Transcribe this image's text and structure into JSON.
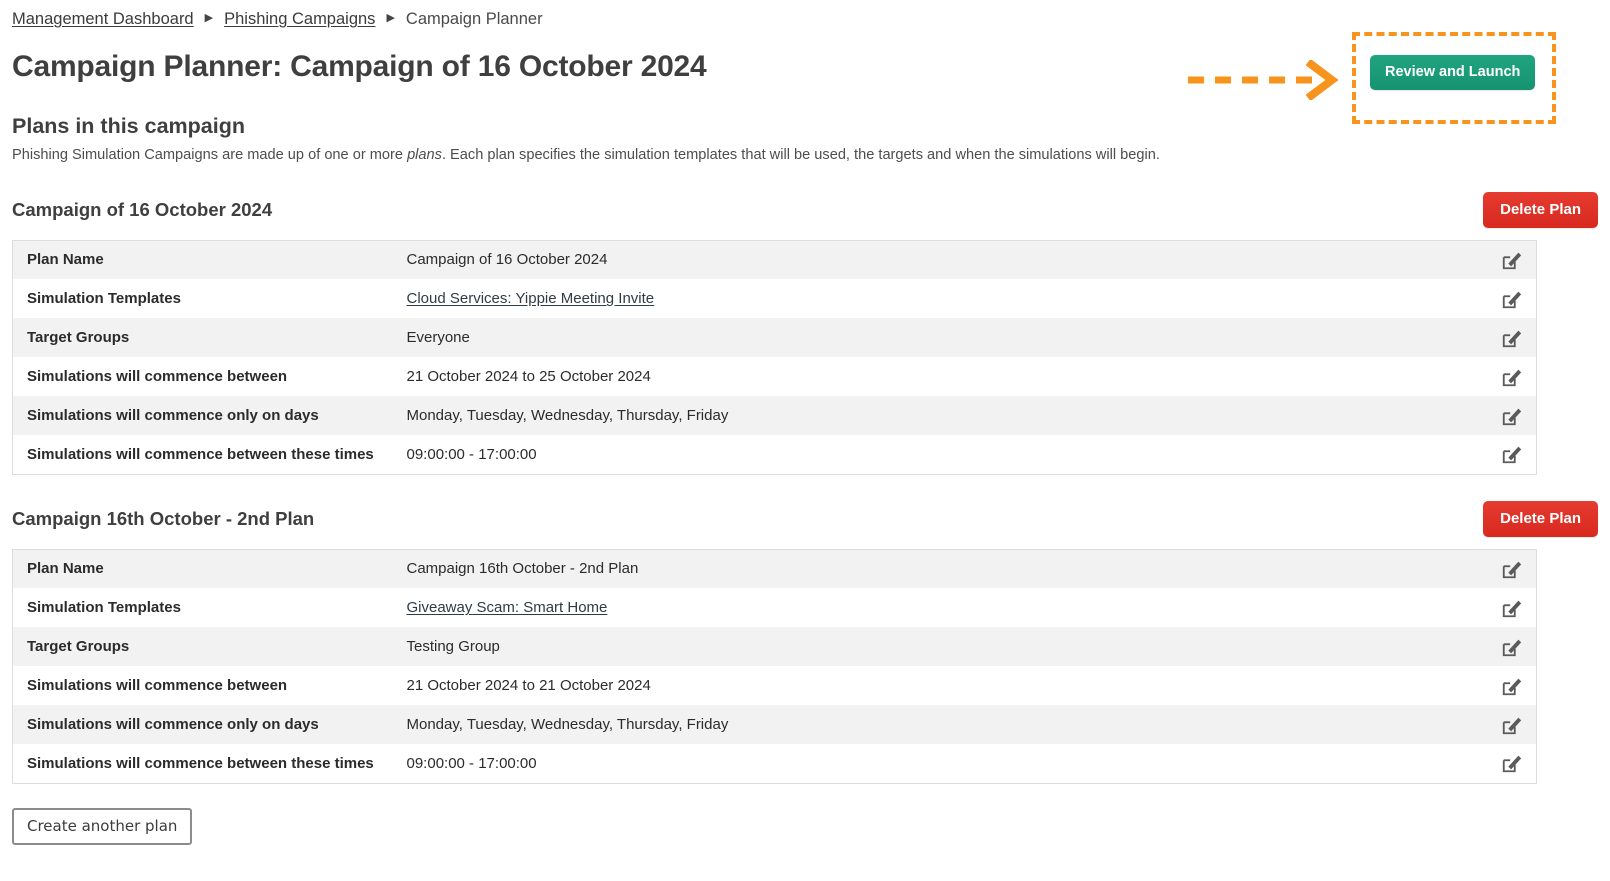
{
  "breadcrumb": {
    "separator": "▶",
    "items": [
      {
        "label": "Management Dashboard",
        "link": true
      },
      {
        "label": "Phishing Campaigns",
        "link": true
      },
      {
        "label": "Campaign Planner",
        "link": false
      }
    ]
  },
  "header": {
    "title": "Campaign Planner: Campaign of 16 October 2024",
    "review_launch_label": "Review and Launch"
  },
  "section": {
    "title": "Plans in this campaign",
    "desc_part1": "Phishing Simulation Campaigns are made up of one or more ",
    "desc_italic": "plans",
    "desc_part2": ". Each plan specifies the simulation templates that will be used, the targets and when the simulations will begin."
  },
  "labels": {
    "plan_name": "Plan Name",
    "simulation_templates": "Simulation Templates",
    "target_groups": "Target Groups",
    "commence_between": "Simulations will commence between",
    "commence_days": "Simulations will commence only on days",
    "commence_times": "Simulations will commence between these times",
    "delete_plan": "Delete Plan",
    "create_another_plan": "Create another plan",
    "edit_icon": "edit-icon"
  },
  "plans": [
    {
      "heading": "Campaign of 16 October 2024",
      "delete_label": "Delete Plan",
      "rows": [
        {
          "label": "Plan Name",
          "value": "Campaign of 16 October 2024",
          "is_link": false
        },
        {
          "label": "Simulation Templates",
          "value": "Cloud Services: Yippie Meeting Invite",
          "is_link": true
        },
        {
          "label": "Target Groups",
          "value": "Everyone",
          "is_link": false
        },
        {
          "label": "Simulations will commence between",
          "value": "21 October 2024 to 25 October 2024",
          "is_link": false
        },
        {
          "label": "Simulations will commence only on days",
          "value": "Monday, Tuesday, Wednesday, Thursday, Friday",
          "is_link": false
        },
        {
          "label": "Simulations will commence between these times",
          "value": "09:00:00 - 17:00:00",
          "is_link": false
        }
      ]
    },
    {
      "heading": "Campaign 16th October - 2nd Plan",
      "delete_label": "Delete Plan",
      "rows": [
        {
          "label": "Plan Name",
          "value": "Campaign 16th October - 2nd Plan",
          "is_link": false
        },
        {
          "label": "Simulation Templates",
          "value": "Giveaway Scam: Smart Home",
          "is_link": true
        },
        {
          "label": "Target Groups",
          "value": "Testing Group",
          "is_link": false
        },
        {
          "label": "Simulations will commence between",
          "value": "21 October 2024 to 21 October 2024",
          "is_link": false
        },
        {
          "label": "Simulations will commence only on days",
          "value": "Monday, Tuesday, Wednesday, Thursday, Friday",
          "is_link": false
        },
        {
          "label": "Simulations will commence between these times",
          "value": "09:00:00 - 17:00:00",
          "is_link": false
        }
      ]
    }
  ],
  "footer": {
    "create_another_plan": "Create another plan"
  },
  "colors": {
    "accent_green": "#1a9e78",
    "danger_red": "#d8291f",
    "annotation_orange": "#f7941d",
    "row_stripe": "#f2f2f2",
    "text": "#2b2b2b"
  }
}
